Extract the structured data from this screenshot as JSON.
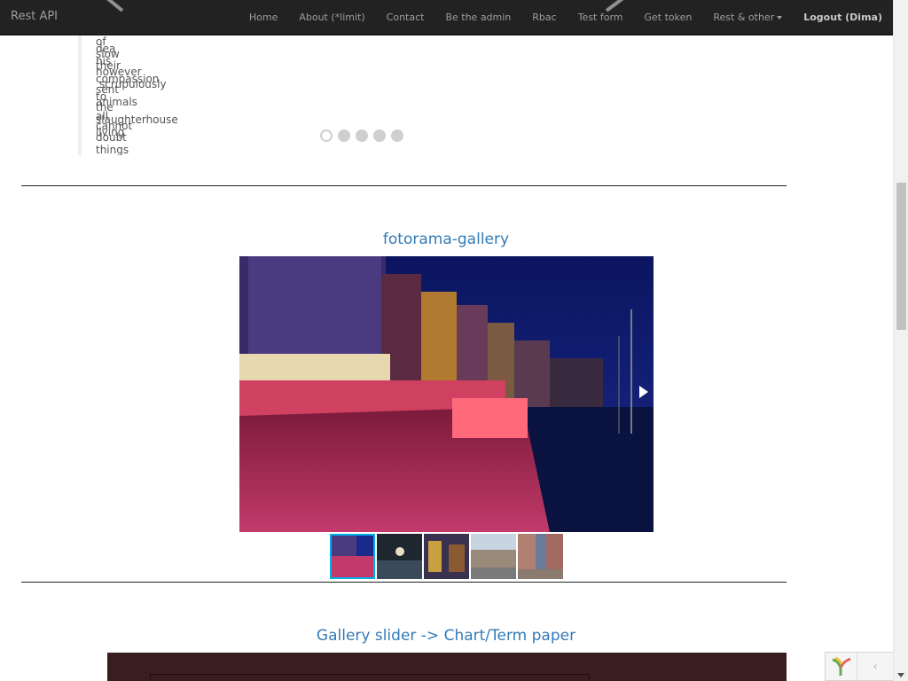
{
  "navbar": {
    "brand": "Rest API",
    "items": [
      {
        "label": "Home"
      },
      {
        "label": "About (*limit)"
      },
      {
        "label": "Contact"
      },
      {
        "label": "Be the admin"
      },
      {
        "label": "Rbac"
      },
      {
        "label": "Test form"
      },
      {
        "label": "Get token"
      },
      {
        "label": "Rest & other"
      },
      {
        "label": "Logout (Dima)"
      }
    ]
  },
  "overlap_text": [
    "of",
    "slow",
    "his",
    "their",
    "however",
    "compassion",
    "to",
    "animals",
    "all",
    "slaughterhouse",
    "living",
    "doubt",
    "things",
    "scrupulously",
    "sent",
    "the",
    "dea",
    "cannot"
  ],
  "slider": {
    "dot_count": 5,
    "active_index": 0
  },
  "gallery": {
    "title": "fotorama-gallery",
    "thumbnail_count": 5,
    "active_thumbnail": 0
  },
  "slider_section": {
    "title": "Gallery slider -> Chart/Term paper"
  },
  "debug_toolbar": {
    "collapse_glyph": "‹"
  },
  "colors": {
    "navbar_bg": "#222222",
    "link": "#337ab7",
    "thumb_active": "#00afea",
    "dark_box": "#3a1d1f"
  }
}
